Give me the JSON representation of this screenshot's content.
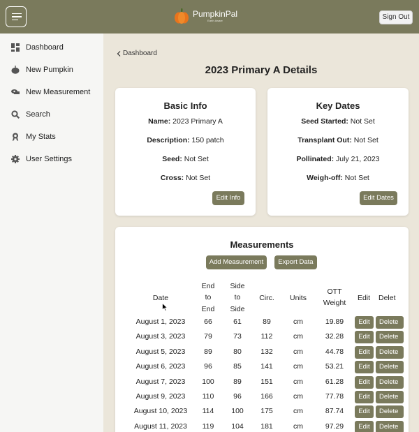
{
  "header": {
    "brand_name": "PumpkinPal",
    "brand_tagline": "Earth Aware",
    "sign_out_label": "Sign Out"
  },
  "sidebar": {
    "items": [
      {
        "label": "Dashboard",
        "icon": "dashboard-icon"
      },
      {
        "label": "New Pumpkin",
        "icon": "pumpkin-icon"
      },
      {
        "label": "New Measurement",
        "icon": "ruler-icon"
      },
      {
        "label": "Search",
        "icon": "search-icon"
      },
      {
        "label": "My Stats",
        "icon": "award-icon"
      },
      {
        "label": "User Settings",
        "icon": "gear-icon"
      }
    ]
  },
  "main": {
    "breadcrumb": "Dashboard",
    "title": "2023 Primary A Details"
  },
  "basic_info": {
    "title": "Basic Info",
    "fields": [
      {
        "label": "Name:",
        "value": " 2023 Primary A"
      },
      {
        "label": "Description:",
        "value": " 150 patch"
      },
      {
        "label": "Seed:",
        "value": " Not Set"
      },
      {
        "label": "Cross:",
        "value": " Not Set"
      }
    ],
    "button": "Edit Info"
  },
  "key_dates": {
    "title": "Key Dates",
    "fields": [
      {
        "label": "Seed Started:",
        "value": " Not Set"
      },
      {
        "label": "Transplant Out:",
        "value": " Not Set"
      },
      {
        "label": "Pollinated:",
        "value": " July 21, 2023"
      },
      {
        "label": "Weigh-off:",
        "value": " Not Set"
      }
    ],
    "button": "Edit Dates"
  },
  "measurements": {
    "title": "Measurements",
    "add_button": "Add Measurement",
    "export_button": "Export Data",
    "columns": [
      "Date",
      "End\nto\nEnd",
      "Side\nto\nSide",
      "Circ.",
      "Units",
      "OTT\nWeight",
      "Edit",
      "Delet"
    ],
    "edit_label": "Edit",
    "delete_label": "Delete",
    "rows": [
      [
        "August 1, 2023",
        "66",
        "61",
        "89",
        "cm",
        "19.89"
      ],
      [
        "August 3, 2023",
        "79",
        "73",
        "112",
        "cm",
        "32.28"
      ],
      [
        "August 5, 2023",
        "89",
        "80",
        "132",
        "cm",
        "44.78"
      ],
      [
        "August 6, 2023",
        "96",
        "85",
        "141",
        "cm",
        "53.21"
      ],
      [
        "August 7, 2023",
        "100",
        "89",
        "151",
        "cm",
        "61.28"
      ],
      [
        "August 9, 2023",
        "110",
        "96",
        "166",
        "cm",
        "77.78"
      ],
      [
        "August 10, 2023",
        "114",
        "100",
        "175",
        "cm",
        "87.74"
      ],
      [
        "August 11, 2023",
        "119",
        "104",
        "181",
        "cm",
        "97.29"
      ]
    ]
  },
  "colors": {
    "accent": "#7a7a5c",
    "background": "#ebe6da",
    "sidebar": "#f6f6f4"
  }
}
